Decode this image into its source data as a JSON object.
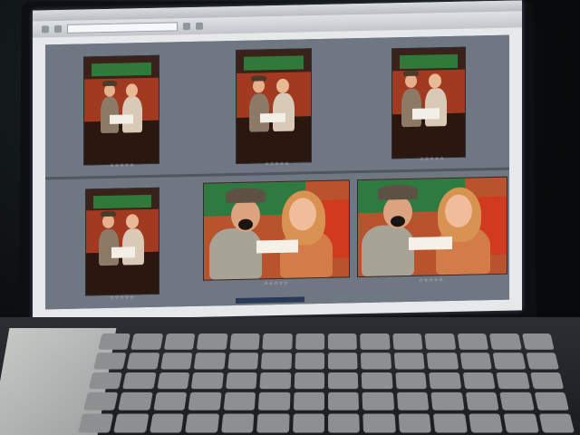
{
  "window": {
    "menu": [
      "",
      "",
      "",
      "",
      "",
      "",
      "",
      ""
    ]
  },
  "photos": [
    {
      "stars": "☆☆☆☆☆",
      "filename": ""
    },
    {
      "stars": "☆☆☆☆☆",
      "filename": ""
    },
    {
      "stars": "☆☆☆☆☆",
      "filename": ""
    },
    {
      "stars": "☆☆☆☆☆",
      "filename": ""
    },
    {
      "stars": "☆☆☆☆☆",
      "filename": ""
    },
    {
      "stars": "☆☆☆☆☆",
      "filename": ""
    }
  ],
  "colors": {
    "grid_bg": "#6f7782",
    "backdrop_red": "#a23a22",
    "sign_green": "#2f7a38"
  }
}
